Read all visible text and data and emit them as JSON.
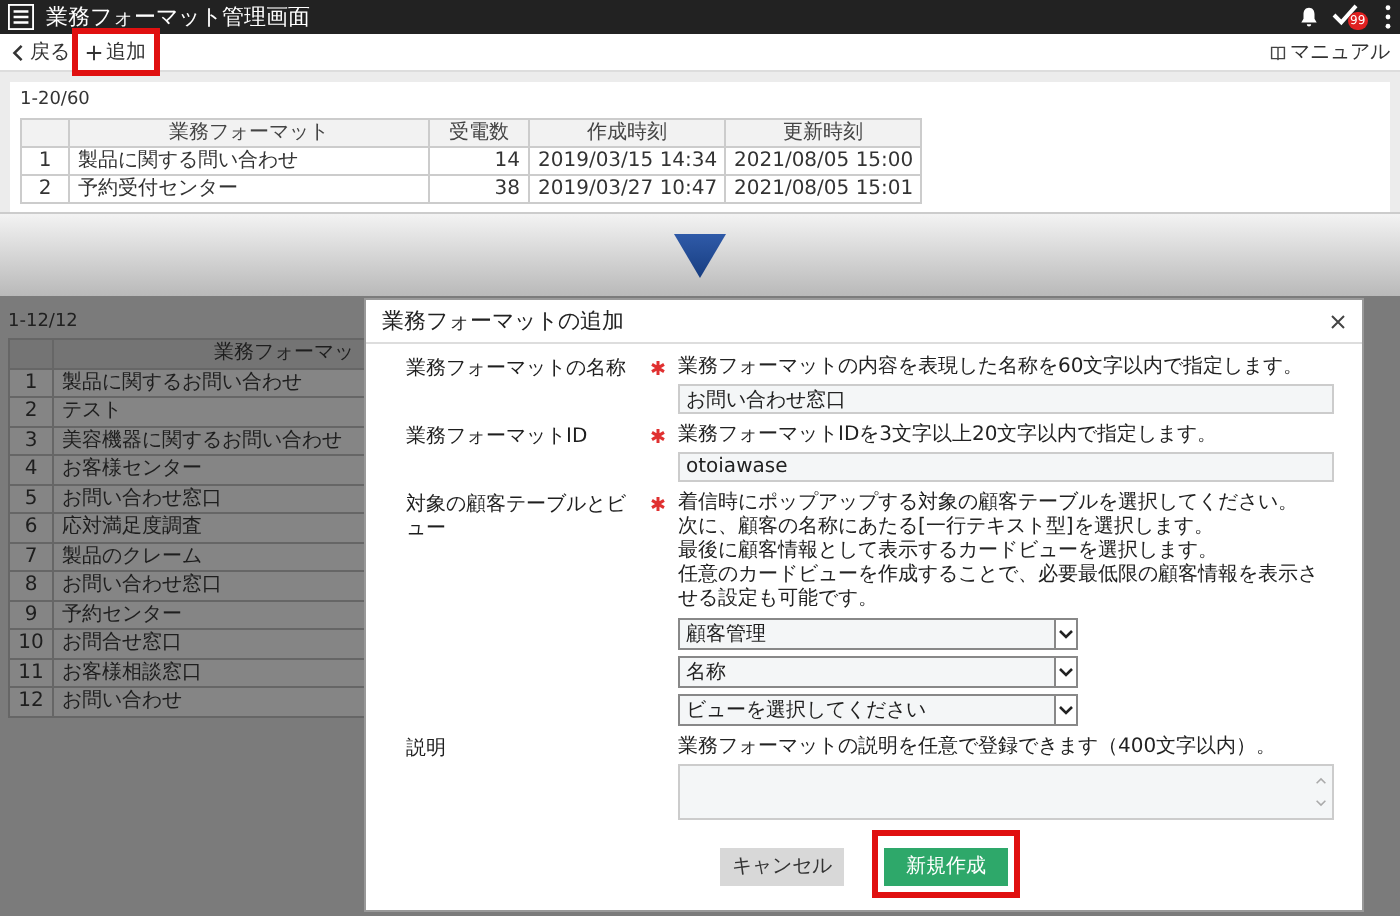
{
  "top_screen": {
    "app_bar": {
      "title": "業務フォーマット管理画面",
      "badge": "99"
    },
    "toolbar": {
      "back": "戻る",
      "add": {
        "label": "追加",
        "highlighted": true
      },
      "manual": "マニュアル"
    },
    "range": "1-20/60",
    "table": {
      "columns": [
        "業務フォーマット",
        "受電数",
        "作成時刻",
        "更新時刻"
      ],
      "rows": [
        {
          "no": "1",
          "name": "製品に関する問い合わせ",
          "calls": "14",
          "created": "2019/03/15 14:34",
          "updated": "2021/08/05 15:00"
        },
        {
          "no": "2",
          "name": "予約受付センター",
          "calls": "38",
          "created": "2019/03/27 10:47",
          "updated": "2021/08/05 15:01"
        }
      ]
    }
  },
  "bottom_screen": {
    "range": "1-12/12",
    "table": {
      "columns": [
        "業務フォーマッ"
      ],
      "rows": [
        {
          "no": "1",
          "name": "製品に関するお問い合わせ"
        },
        {
          "no": "2",
          "name": "テスト"
        },
        {
          "no": "3",
          "name": "美容機器に関するお問い合わせ"
        },
        {
          "no": "4",
          "name": "お客様センター"
        },
        {
          "no": "5",
          "name": "お問い合わせ窓口"
        },
        {
          "no": "6",
          "name": "応対満足度調査"
        },
        {
          "no": "7",
          "name": "製品のクレーム"
        },
        {
          "no": "8",
          "name": "お問い合わせ窓口"
        },
        {
          "no": "9",
          "name": "予約センター"
        },
        {
          "no": "10",
          "name": "お問合せ窓口"
        },
        {
          "no": "11",
          "name": "お客様相談窓口"
        },
        {
          "no": "12",
          "name": "お問い合わせ"
        }
      ]
    },
    "dialog": {
      "title": "業務フォーマットの追加",
      "fields": [
        {
          "kind": "text",
          "label": "業務フォーマットの名称",
          "required": true,
          "help_lines": [
            "業務フォーマットの内容を表現した名称を60文字以内で指定します。"
          ],
          "value": "お問い合わせ窓口"
        },
        {
          "kind": "text",
          "label": "業務フォーマットID",
          "required": true,
          "help_lines": [
            "業務フォーマットIDを3文字以上20文字以内で指定します。"
          ],
          "value": "otoiawase"
        },
        {
          "kind": "select",
          "label": "対象の顧客テーブルとビュー",
          "required": true,
          "help_lines": [
            "着信時にポップアップする対象の顧客テーブルを選択してください。",
            "次に、顧客の名称にあたる[一行テキスト型]を選択します。",
            "最後に顧客情報として表示するカードビューを選択します。",
            "任意のカードビューを作成することで、必要最低限の顧客情報を表示させる設定も可能です。"
          ],
          "selects": [
            "顧客管理",
            "名称",
            "ビューを選択してください"
          ]
        },
        {
          "kind": "textarea",
          "label": "説明",
          "required": false,
          "help_lines": [
            "業務フォーマットの説明を任意で登録できます（400文字以内）。"
          ]
        }
      ],
      "buttons": [
        {
          "kind": "secondary",
          "label": "キャンセル",
          "highlighted": false
        },
        {
          "kind": "primary",
          "label": "新規作成",
          "highlighted": true
        }
      ]
    }
  }
}
